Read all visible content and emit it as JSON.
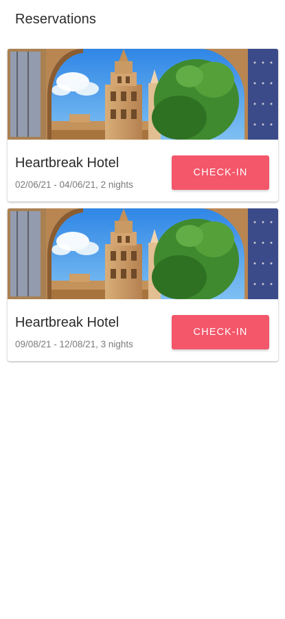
{
  "header": {
    "title": "Reservations"
  },
  "reservations": [
    {
      "hotel_name": "Heartbreak Hotel",
      "stay": "02/06/21 - 04/06/21, 2 nights",
      "checkin_label": "CHECK-IN"
    },
    {
      "hotel_name": "Heartbreak Hotel",
      "stay": "09/08/21 - 12/08/21, 3 nights",
      "checkin_label": "CHECK-IN"
    }
  ],
  "colors": {
    "accent": "#f4566a",
    "sky": "#3d8fe0",
    "stone": "#c99a63",
    "foliage": "#3f8a2e"
  }
}
